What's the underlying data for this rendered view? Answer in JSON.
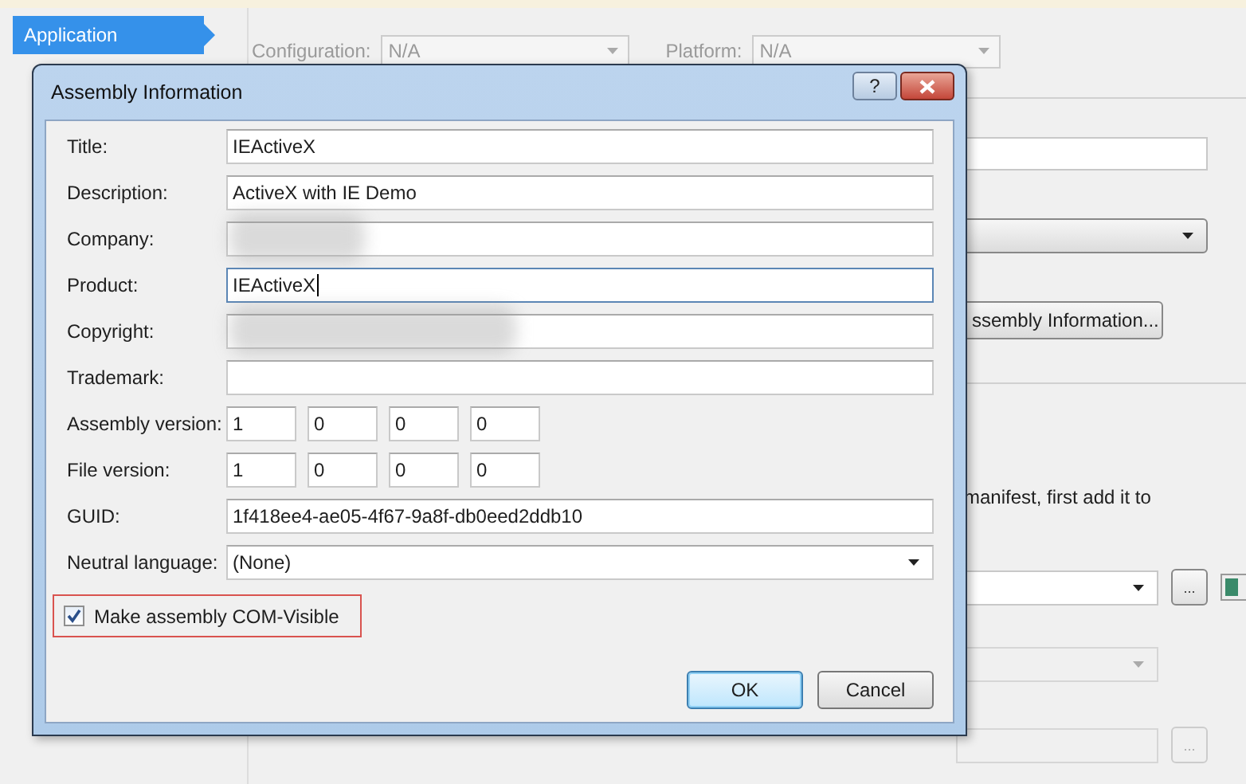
{
  "project_nav": {
    "items": [
      {
        "label": "Application",
        "selected": true
      }
    ]
  },
  "toolbar": {
    "configuration_label": "Configuration:",
    "configuration_value": "N/A",
    "platform_label": "Platform:",
    "platform_value": "N/A",
    "disabled": true
  },
  "background": {
    "assembly_button": "ssembly Information...",
    "note": "manifest, first add it to",
    "icon_combo": {
      "disabled": false,
      "browse_button": "..."
    },
    "lower_combo": {
      "disabled": true
    },
    "lower_field": {
      "disabled": true,
      "browse_button": "..."
    }
  },
  "dialog": {
    "title": "Assembly Information",
    "help_button": "?",
    "fields": [
      {
        "label": "Title:",
        "kind": "text",
        "value": "IEActiveX",
        "focused": false
      },
      {
        "label": "Description:",
        "kind": "text",
        "value": "ActiveX with IE Demo",
        "focused": false
      },
      {
        "label": "Company:",
        "kind": "text",
        "focused": false,
        "redacted": true
      },
      {
        "label": "Product:",
        "kind": "text",
        "value": "IEActiveX",
        "focused": true
      },
      {
        "label": "Copyright:",
        "kind": "text",
        "focused": false,
        "redacted": true
      },
      {
        "label": "Trademark:",
        "kind": "text",
        "focused": false
      },
      {
        "label": "Assembly version:",
        "kind": "version",
        "parts": [
          "1",
          "0",
          "0",
          "0"
        ]
      },
      {
        "label": "File version:",
        "kind": "version",
        "parts": [
          "1",
          "0",
          "0",
          "0"
        ]
      },
      {
        "label": "GUID:",
        "kind": "text",
        "value": "1f418ee4-ae05-4f67-9a8f-db0eed2ddb10",
        "focused": false
      },
      {
        "label": "Neutral language:",
        "kind": "combo",
        "value": "(None)"
      }
    ],
    "checkbox": {
      "label": "Make assembly COM-Visible",
      "checked": true,
      "highlighted": true
    },
    "buttons": [
      {
        "label": "OK",
        "default": true
      },
      {
        "label": "Cancel",
        "default": false
      }
    ]
  }
}
